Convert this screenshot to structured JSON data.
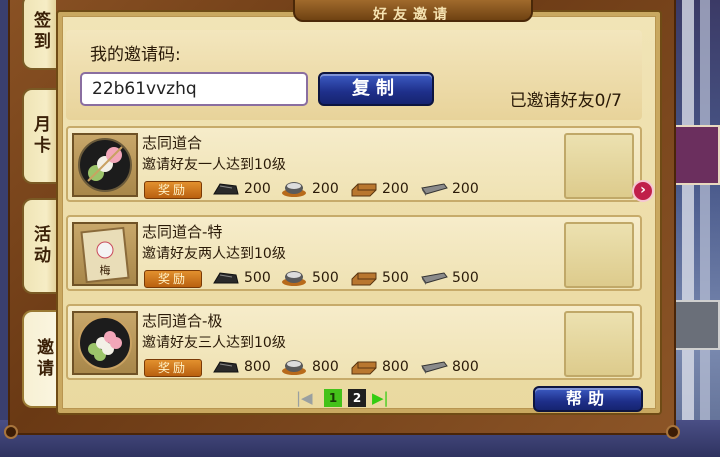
{
  "window": {
    "title": "好友邀请"
  },
  "tabs": [
    {
      "label": "签到"
    },
    {
      "label": "月卡"
    },
    {
      "label": "活动"
    },
    {
      "label": "邀请"
    }
  ],
  "invite": {
    "label": "我的邀请码:",
    "code": "22b61vvzhq",
    "copy_label": "复制",
    "invited_text": "已邀请好友0/7"
  },
  "quests": [
    {
      "title": "志同道合",
      "desc": "邀请好友一人达到10级",
      "reward_label": "奖励",
      "rewards": [
        "200",
        "200",
        "200",
        "200"
      ]
    },
    {
      "title": "志同道合-特",
      "desc": "邀请好友两人达到10级",
      "reward_label": "奖励",
      "rewards": [
        "500",
        "500",
        "500",
        "500"
      ]
    },
    {
      "title": "志同道合-极",
      "desc": "邀请好友三人达到10级",
      "reward_label": "奖励",
      "rewards": [
        "800",
        "800",
        "800",
        "800"
      ]
    }
  ],
  "pager": {
    "pages": [
      "1",
      "2"
    ],
    "current": "1"
  },
  "help_label": "帮助",
  "icons": {
    "resource_1": "iron-ore-icon",
    "resource_2": "rice-bowl-icon",
    "resource_3": "wood-plank-icon",
    "resource_4": "steel-ingot-icon",
    "next": "chevron-right-icon"
  }
}
